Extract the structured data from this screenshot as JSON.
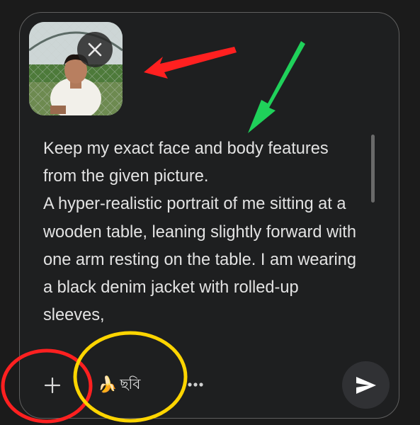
{
  "composer": {
    "attachment": {
      "alt": "uploaded photo",
      "remove_icon": "close-icon"
    },
    "prompt_text": "Keep my exact face and body features from the given picture.\nA hyper-realistic portrait of me sitting at a wooden table, leaning slightly forward with one arm resting on the table. I am wearing a black denim jacket with rolled-up sleeves,",
    "toolbar": {
      "add_icon": "plus-icon",
      "tool_emoji": "🍌",
      "tool_label": "ছবি",
      "more_icon": "more-horizontal-icon",
      "send_icon": "send-icon"
    }
  },
  "annotations": [
    {
      "kind": "arrow",
      "color": "#ff2020"
    },
    {
      "kind": "arrow",
      "color": "#1fd15a"
    },
    {
      "kind": "ellipse",
      "color": "#ff2020"
    },
    {
      "kind": "ellipse",
      "color": "#ffd500"
    }
  ],
  "colors": {
    "background": "#1b1b1b",
    "composer_bg": "#1e1f20",
    "border": "#5f5f5f",
    "text": "#e3e3e3",
    "send_bg": "#303134"
  }
}
